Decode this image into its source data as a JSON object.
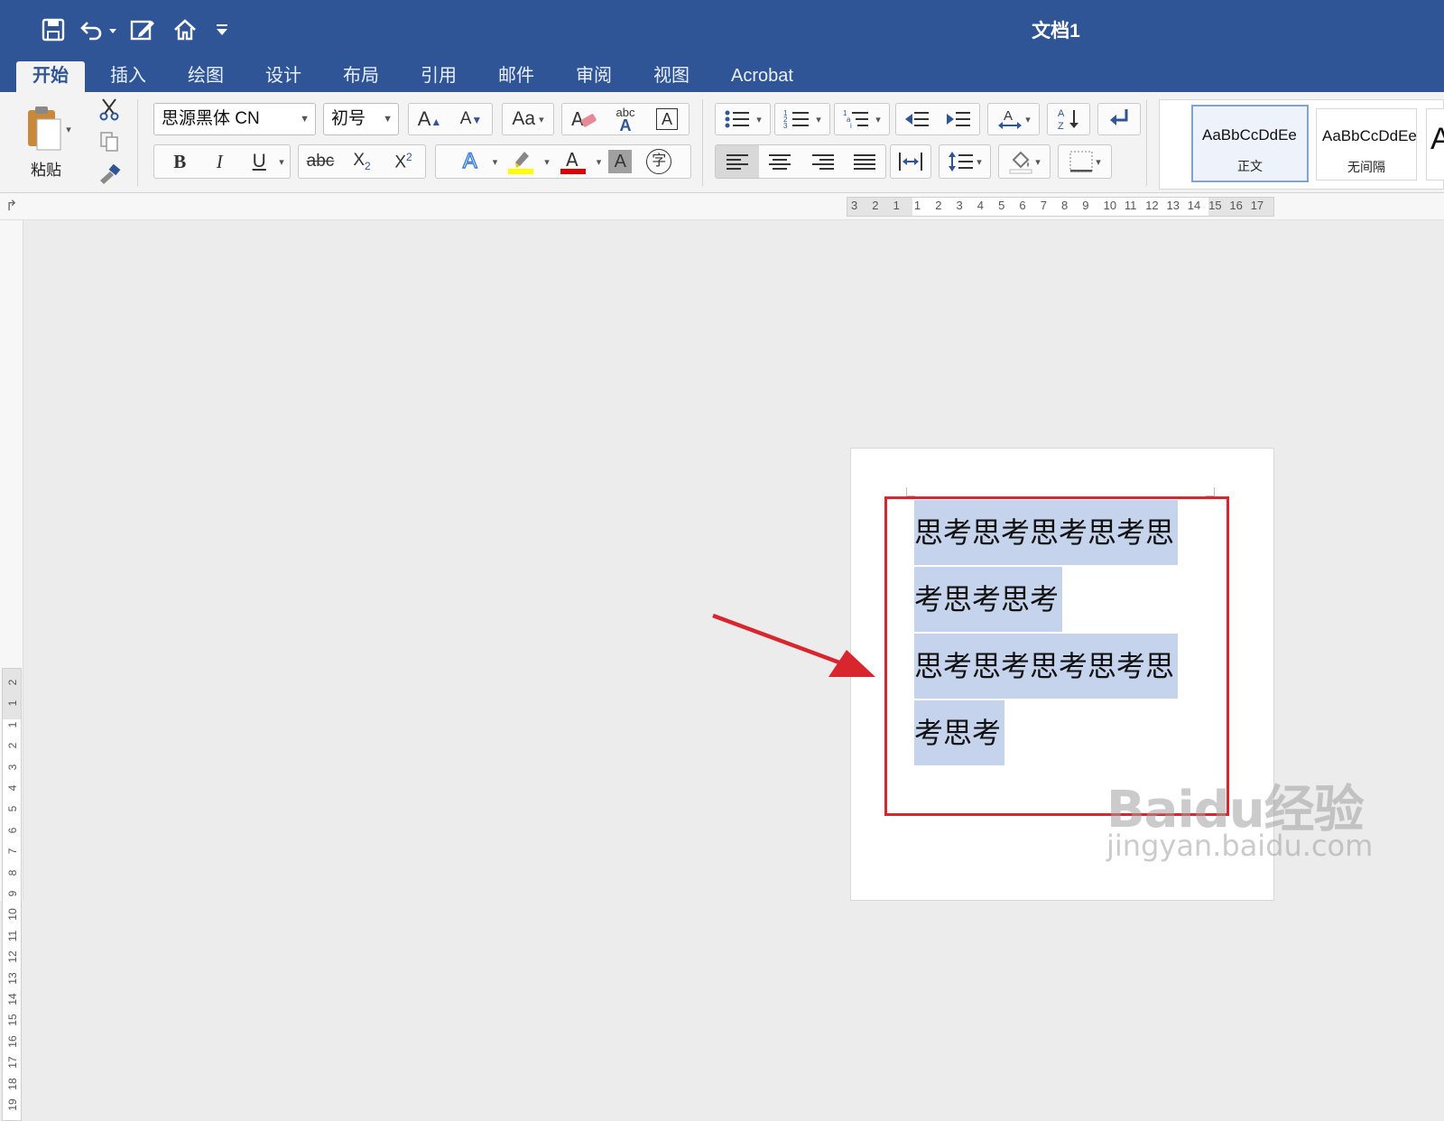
{
  "window": {
    "title": "文档1"
  },
  "quick_access": [
    "save-icon",
    "undo-icon",
    "edit-document-icon",
    "home-icon",
    "customize-icon"
  ],
  "tabs": [
    {
      "label": "开始",
      "active": true
    },
    {
      "label": "插入",
      "active": false
    },
    {
      "label": "绘图",
      "active": false
    },
    {
      "label": "设计",
      "active": false
    },
    {
      "label": "布局",
      "active": false
    },
    {
      "label": "引用",
      "active": false
    },
    {
      "label": "邮件",
      "active": false
    },
    {
      "label": "审阅",
      "active": false
    },
    {
      "label": "视图",
      "active": false
    },
    {
      "label": "Acrobat",
      "active": false
    }
  ],
  "ribbon": {
    "paste_label": "粘贴",
    "font_name": "思源黑体 CN",
    "font_size": "初号",
    "grow_label": "A",
    "shrink_label": "A",
    "change_case_label": "Aa",
    "spell_label": "abc",
    "bold": "B",
    "italic": "I",
    "underline": "U",
    "strike": "abc",
    "subscript": "X",
    "superscript": "X",
    "char_shading": "A",
    "enclose_char": "字",
    "highlight_color": "#ffff00",
    "font_color": "#e00000",
    "styles": [
      {
        "sample": "AaBbCcDdEe",
        "name": "正文",
        "selected": true
      },
      {
        "sample": "AaBbCcDdEe",
        "name": "无间隔",
        "selected": false
      }
    ]
  },
  "ruler": {
    "h_numbers": [
      "3",
      "2",
      "1",
      "1",
      "2",
      "3",
      "4",
      "5",
      "6",
      "7",
      "8",
      "9",
      "10",
      "11",
      "12",
      "13",
      "14",
      "15",
      "16",
      "17"
    ],
    "v_numbers": [
      "2",
      "1",
      "1",
      "2",
      "3",
      "4",
      "5",
      "6",
      "7",
      "8",
      "9",
      "10",
      "11",
      "12",
      "13",
      "14",
      "15",
      "16",
      "17",
      "18",
      "19"
    ]
  },
  "document": {
    "lines": [
      "思考思考思考思考思",
      "考思考思考",
      "思考思考思考思考思",
      "考思考"
    ]
  },
  "annotation": {
    "color": "#d9252e"
  },
  "watermark": {
    "brand": "Baidu经验",
    "url": "jingyan.baidu.com"
  }
}
